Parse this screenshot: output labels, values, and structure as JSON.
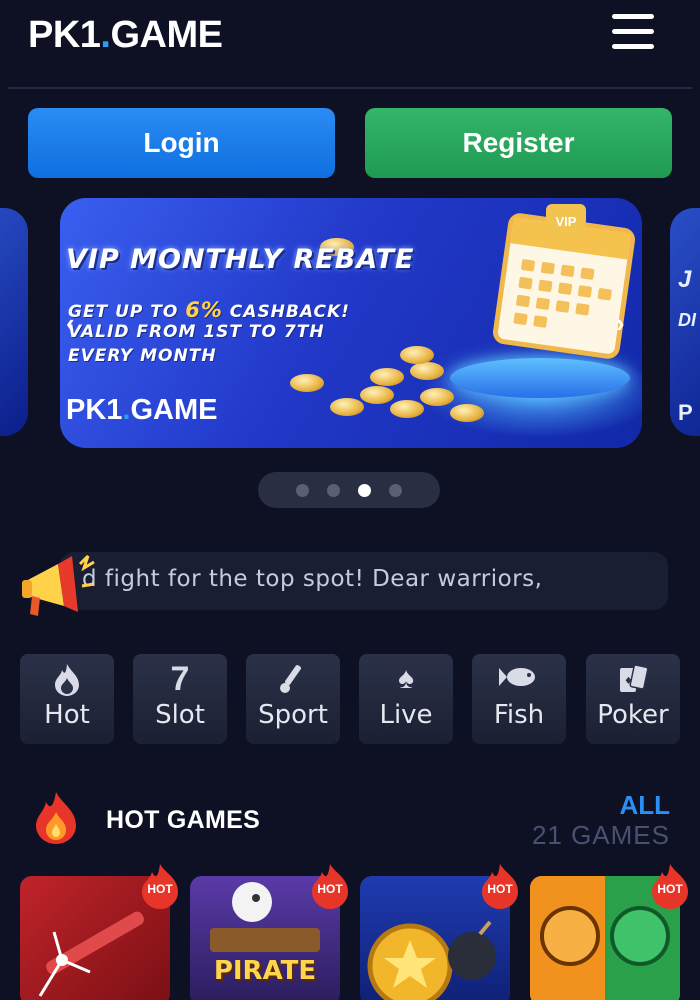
{
  "header": {
    "logo_left": "PK1",
    "logo_dot": ".",
    "logo_right": "GAME",
    "menu_icon": "hamburger-menu-icon"
  },
  "auth": {
    "login_label": "Login",
    "register_label": "Register"
  },
  "carousel": {
    "banner_title": "VIP MONTHLY REBATE",
    "line1_prefix": "GET UP TO ",
    "line1_pct": "6%",
    "line1_suffix": " CASHBACK!",
    "line2": "VALID FROM 1ST TO 7TH",
    "line3": "EVERY MONTH",
    "vip_badge": "VIP",
    "banner_logo_left": "PK1",
    "banner_logo_dot": ".",
    "banner_logo_right": "GAME",
    "right_card_line1": "J",
    "right_card_line2": "DI",
    "right_card_line3": "P",
    "dots_count": 4,
    "active_dot": 3
  },
  "marquee": {
    "text": "d fight for the top spot!     Dear warriors,"
  },
  "categories": [
    {
      "label": "Hot",
      "icon": "flame-icon"
    },
    {
      "label": "Slot",
      "icon": "seven-icon"
    },
    {
      "label": "Sport",
      "icon": "cricket-icon"
    },
    {
      "label": "Live",
      "icon": "spade-icon"
    },
    {
      "label": "Fish",
      "icon": "fish-icon"
    },
    {
      "label": "Poker",
      "icon": "cards-icon"
    }
  ],
  "hot_games": {
    "title": "HOT GAMES",
    "all_label": "ALL",
    "count_label": "21 GAMES",
    "tag_label": "HOT",
    "games": [
      {
        "name": ""
      },
      {
        "name": "PIRATE"
      },
      {
        "name": ""
      },
      {
        "name": ""
      }
    ]
  },
  "colors": {
    "background": "#0e1124",
    "login": "#1a7fe9",
    "register": "#28a85c",
    "accent": "#2b8ff5"
  }
}
